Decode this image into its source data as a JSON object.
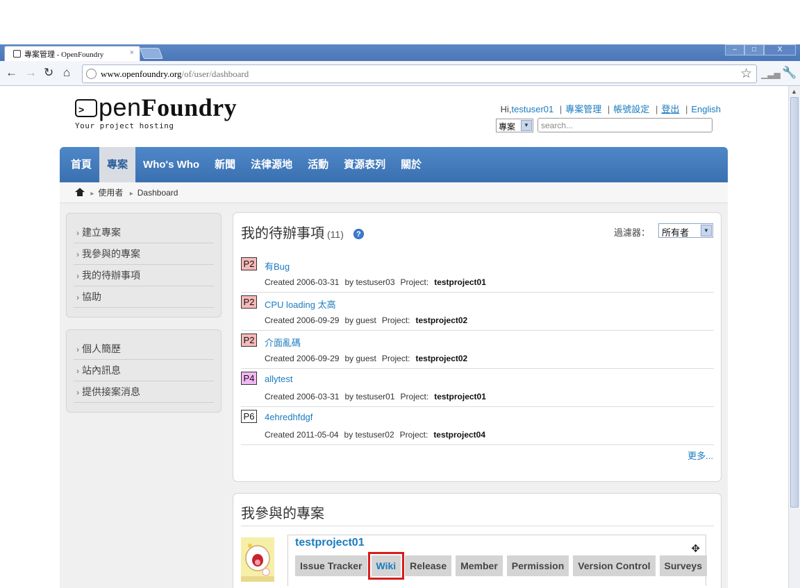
{
  "browser": {
    "tab_title": "專案管理 - OpenFoundry",
    "tab_close": "×",
    "url_host": "www.openfoundry.org",
    "url_path": "/of/user/dashboard",
    "win_minimize": "–",
    "win_maximize": "□",
    "win_close": "X"
  },
  "header": {
    "logo_light": "pen",
    "logo_bold": "Foundry",
    "logo_tagline": "Your project hosting",
    "greeting": "Hi,",
    "username": "testuser01",
    "links": [
      "專案管理",
      "帳號設定",
      "登出",
      "English"
    ],
    "search_scope": "專案",
    "search_placeholder": "search..."
  },
  "nav": {
    "items": [
      "首頁",
      "專案",
      "Who's Who",
      "新聞",
      "法律源地",
      "活動",
      "資源表列",
      "關於"
    ],
    "active_index": 1
  },
  "breadcrumb": [
    "使用者",
    "Dashboard"
  ],
  "sidebar": {
    "group1": [
      "建立專案",
      "我參與的專案",
      "我的待辦事項",
      "協助"
    ],
    "group2": [
      "個人簡歷",
      "站內訊息",
      "提供接案消息"
    ]
  },
  "todo_panel": {
    "title": "我的待辦事項",
    "count": "(11)",
    "help": "?",
    "filter_label": "過濾器：",
    "filter_value": "所有者",
    "created_label": "Created",
    "by_label": "by",
    "project_label": "Project:",
    "more": "更多...",
    "items": [
      {
        "priority": "P2",
        "title": "有Bug",
        "date": "2006-03-31",
        "user": "testuser03",
        "project": "testproject01",
        "color": "#f6b9b9"
      },
      {
        "priority": "P2",
        "title": "CPU loading 太高",
        "date": "2006-09-29",
        "user": "guest",
        "project": "testproject02",
        "color": "#f6b9b9"
      },
      {
        "priority": "P2",
        "title": "介面亂碼",
        "date": "2006-09-29",
        "user": "guest",
        "project": "testproject02",
        "color": "#f6b9b9"
      },
      {
        "priority": "P4",
        "title": "allytest",
        "date": "2006-03-31",
        "user": "testuser01",
        "project": "testproject01",
        "color": "#f2b8f2"
      },
      {
        "priority": "P6",
        "title": "4ehredhfdgf",
        "date": "2011-05-04",
        "user": "testuser02",
        "project": "testproject04",
        "color": "#ffffff"
      }
    ]
  },
  "projects_panel": {
    "title": "我參與的專案",
    "project_name": "testproject01",
    "buttons": [
      "Issue Tracker",
      "Wiki",
      "Release",
      "Member",
      "Permission",
      "Version Control",
      "Surveys"
    ],
    "highlighted_button": "Wiki"
  },
  "colors": {
    "nav_bg": "#3f78bb",
    "link": "#1a7bbf",
    "highlight_box": "#d81c1c"
  }
}
